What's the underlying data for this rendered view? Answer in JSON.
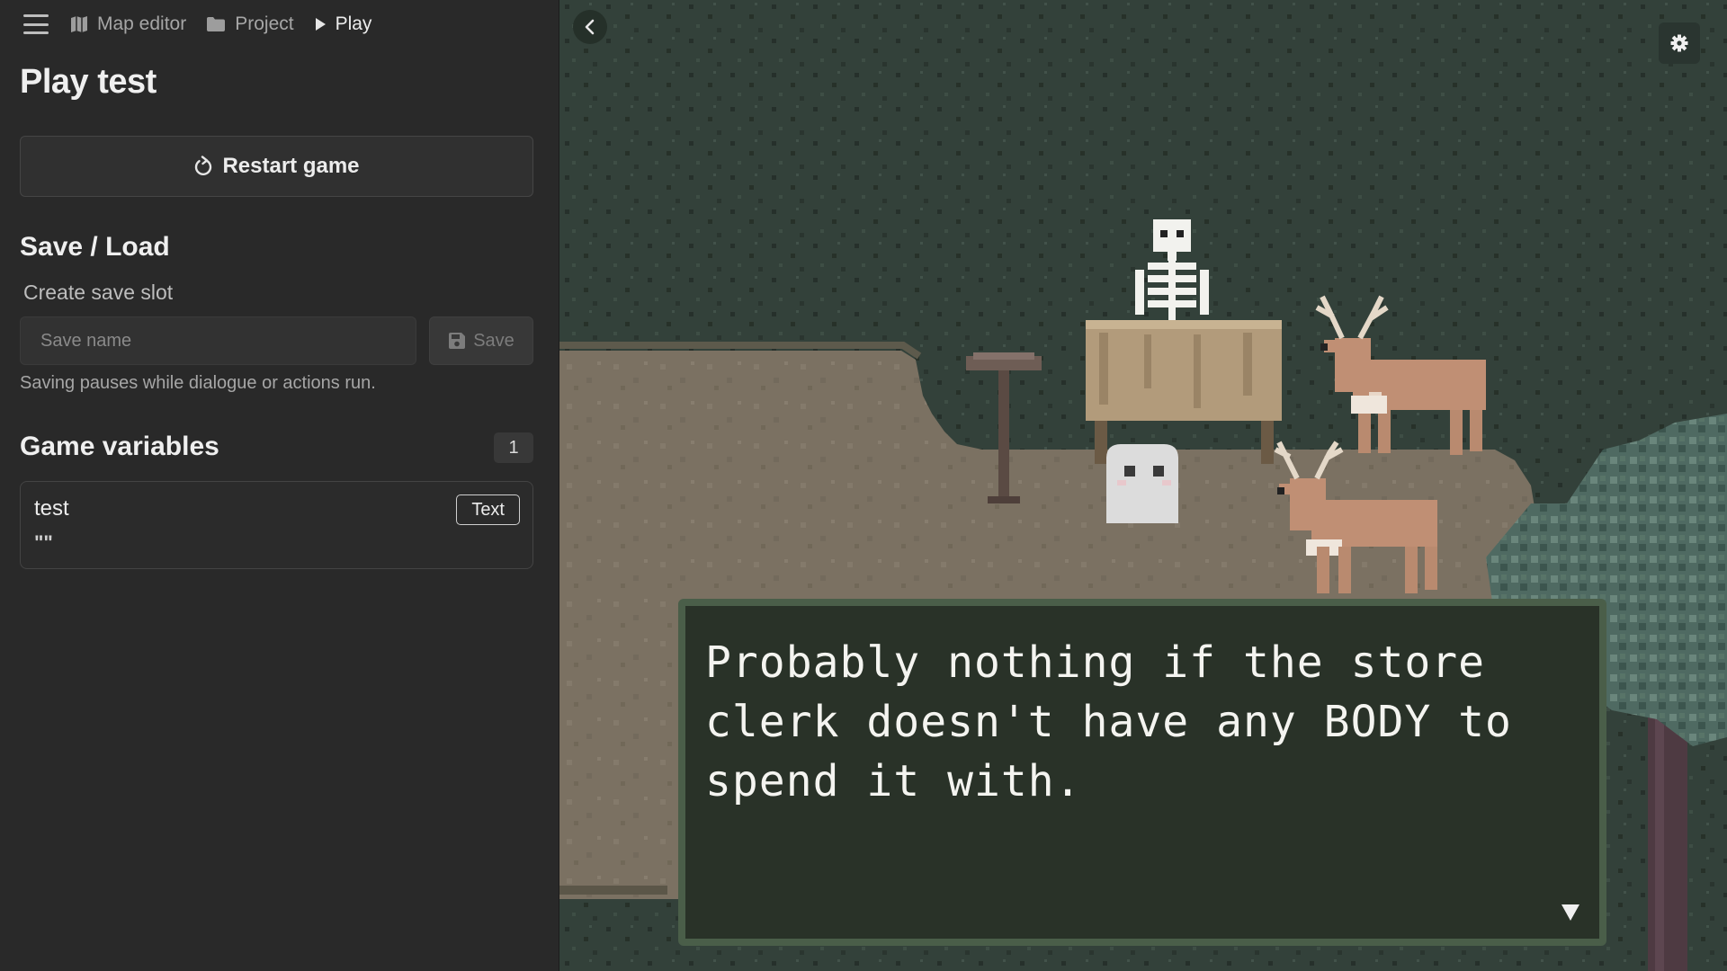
{
  "breadcrumb": {
    "items": [
      {
        "label": "Map editor",
        "icon": "map-icon"
      },
      {
        "label": "Project",
        "icon": "folder-icon"
      },
      {
        "label": "Play",
        "icon": "play-icon"
      }
    ]
  },
  "page": {
    "title": "Play test"
  },
  "restart": {
    "label": "Restart game",
    "icon": "restart-icon"
  },
  "save_load": {
    "title": "Save / Load",
    "create_label": "Create save slot",
    "input_placeholder": "Save name",
    "save_button": "Save",
    "hint": "Saving pauses while dialogue or actions run."
  },
  "variables": {
    "title": "Game variables",
    "count": "1",
    "items": [
      {
        "name": "test",
        "value": "\"\"",
        "type": "Text"
      }
    ]
  },
  "game": {
    "dialogue": "Probably nothing if the store clerk doesn't have any BODY to spend it with.",
    "controls": {
      "collapse": "chevron-left-icon",
      "settings": "gear-icon"
    }
  },
  "colors": {
    "sidebar_bg": "#292929",
    "grass": "#33413a",
    "dirt": "#7a7060",
    "dialog_border": "#4a5e49"
  }
}
